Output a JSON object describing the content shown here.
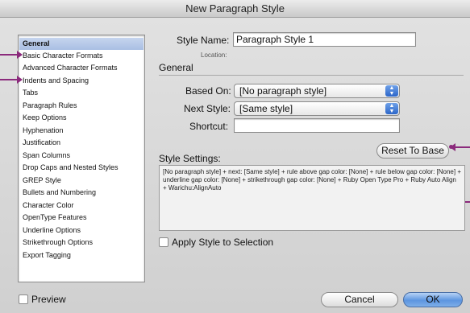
{
  "window": {
    "title": "New Paragraph Style"
  },
  "sidebar": {
    "items": [
      {
        "label": "General",
        "selected": true
      },
      {
        "label": "Basic Character Formats"
      },
      {
        "label": "Advanced Character Formats"
      },
      {
        "label": "Indents and Spacing"
      },
      {
        "label": "Tabs"
      },
      {
        "label": "Paragraph Rules"
      },
      {
        "label": "Keep Options"
      },
      {
        "label": "Hyphenation"
      },
      {
        "label": "Justification"
      },
      {
        "label": "Span Columns"
      },
      {
        "label": "Drop Caps and Nested Styles"
      },
      {
        "label": "GREP Style"
      },
      {
        "label": "Bullets and Numbering"
      },
      {
        "label": "Character Color"
      },
      {
        "label": "OpenType Features"
      },
      {
        "label": "Underline Options"
      },
      {
        "label": "Strikethrough Options"
      },
      {
        "label": "Export Tagging"
      }
    ]
  },
  "form": {
    "style_name_label": "Style Name:",
    "style_name_value": "Paragraph Style 1",
    "location_label": "Location:",
    "general_title": "General",
    "based_on_label": "Based On:",
    "based_on_value": "[No paragraph style]",
    "next_style_label": "Next Style:",
    "next_style_value": "[Same style]",
    "shortcut_label": "Shortcut:",
    "shortcut_value": "",
    "style_settings_label": "Style Settings:",
    "reset_to_base_label": "Reset To Base",
    "style_settings_text": "[No paragraph style] + next: [Same style] + rule above gap color: [None] + rule below gap color: [None] + underline gap color: [None] + strikethrough gap color: [None] + Ruby Open Type Pro + Ruby Auto Align + Warichu:AlignAuto",
    "apply_style_label": "Apply Style to Selection"
  },
  "footer": {
    "preview_label": "Preview",
    "cancel_label": "Cancel",
    "ok_label": "OK"
  },
  "colors": {
    "annotation": "#8b2a7c",
    "selection": "#b4c8ea",
    "default_button": "#5c95e0"
  }
}
